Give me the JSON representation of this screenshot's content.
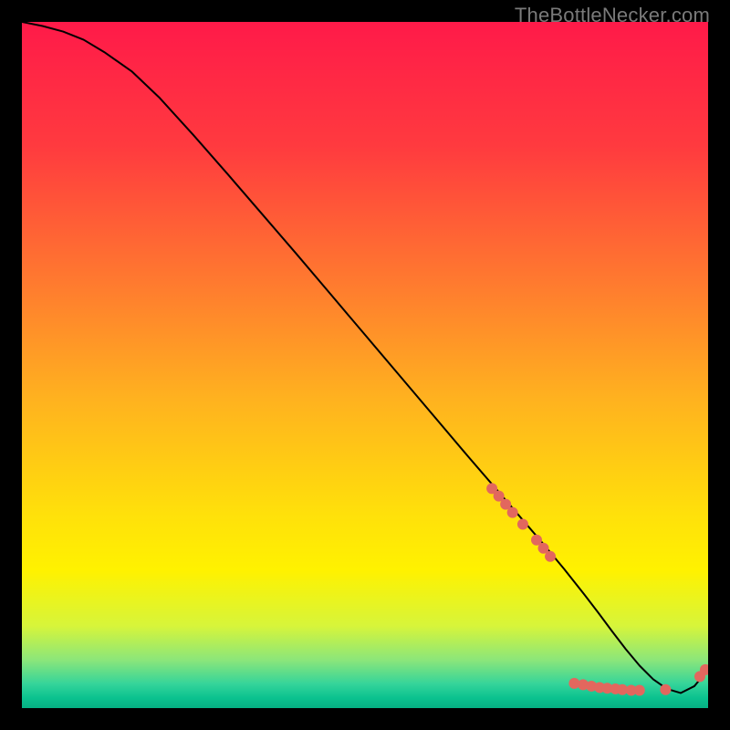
{
  "watermark": "TheBottleNecker.com",
  "chart_data": {
    "type": "line",
    "title": "",
    "xlabel": "",
    "ylabel": "",
    "xlim": [
      0,
      100
    ],
    "ylim": [
      0,
      100
    ],
    "grid": false,
    "background_gradient": {
      "stops": [
        {
          "offset": 0.0,
          "color": "#ff1a49"
        },
        {
          "offset": 0.18,
          "color": "#ff3a3f"
        },
        {
          "offset": 0.38,
          "color": "#ff7a2f"
        },
        {
          "offset": 0.55,
          "color": "#ffb21f"
        },
        {
          "offset": 0.72,
          "color": "#ffe10a"
        },
        {
          "offset": 0.8,
          "color": "#fff200"
        },
        {
          "offset": 0.88,
          "color": "#d7f53a"
        },
        {
          "offset": 0.93,
          "color": "#8be67a"
        },
        {
          "offset": 0.965,
          "color": "#34d49a"
        },
        {
          "offset": 0.985,
          "color": "#0bc28f"
        },
        {
          "offset": 1.0,
          "color": "#06b184"
        }
      ]
    },
    "series": [
      {
        "name": "curve",
        "color": "#000000",
        "width": 2,
        "x": [
          0,
          3,
          6,
          9,
          12,
          16,
          20,
          25,
          30,
          35,
          40,
          45,
          50,
          55,
          60,
          65,
          70,
          73,
          76,
          79,
          82,
          84,
          86,
          88,
          90,
          92,
          94,
          96,
          98,
          99,
          100
        ],
        "y": [
          100,
          99.4,
          98.6,
          97.4,
          95.6,
          92.8,
          89.0,
          83.5,
          77.8,
          72.0,
          66.2,
          60.3,
          54.4,
          48.5,
          42.6,
          36.7,
          30.9,
          27.4,
          23.9,
          20.3,
          16.5,
          13.9,
          11.2,
          8.6,
          6.2,
          4.2,
          2.8,
          2.2,
          3.2,
          4.4,
          5.8
        ]
      }
    ],
    "markers": {
      "color": "#e2675e",
      "radius": 6,
      "points": [
        {
          "x": 68.5,
          "y": 32.0
        },
        {
          "x": 69.5,
          "y": 30.9
        },
        {
          "x": 70.5,
          "y": 29.7
        },
        {
          "x": 71.5,
          "y": 28.5
        },
        {
          "x": 73.0,
          "y": 26.8
        },
        {
          "x": 75.0,
          "y": 24.5
        },
        {
          "x": 76.0,
          "y": 23.3
        },
        {
          "x": 77.0,
          "y": 22.1
        },
        {
          "x": 80.5,
          "y": 3.6
        },
        {
          "x": 81.8,
          "y": 3.4
        },
        {
          "x": 83.0,
          "y": 3.2
        },
        {
          "x": 84.2,
          "y": 3.0
        },
        {
          "x": 85.3,
          "y": 2.9
        },
        {
          "x": 86.5,
          "y": 2.8
        },
        {
          "x": 87.5,
          "y": 2.7
        },
        {
          "x": 88.8,
          "y": 2.6
        },
        {
          "x": 90.0,
          "y": 2.6
        },
        {
          "x": 93.8,
          "y": 2.7
        },
        {
          "x": 98.8,
          "y": 4.6
        },
        {
          "x": 99.6,
          "y": 5.6
        }
      ]
    }
  }
}
